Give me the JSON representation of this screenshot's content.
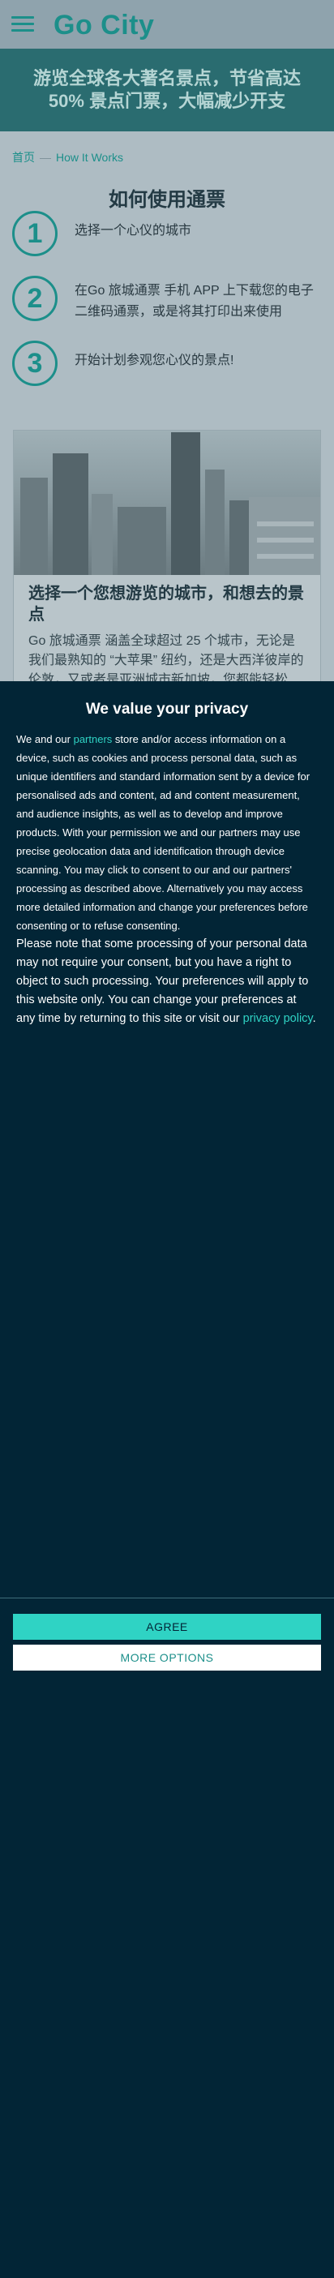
{
  "header": {
    "logo": "Go City"
  },
  "hero": {
    "title": "游览全球各大著名景点，节省高达 50% 景点门票，大幅减少开支"
  },
  "breadcrumb": {
    "home": "首页",
    "separator": "—",
    "current": "How It Works"
  },
  "how": {
    "title": "如何使用通票",
    "steps": [
      {
        "num": "1",
        "text": "选择一个心仪的城市"
      },
      {
        "num": "2",
        "text": "在Go 旅城通票 手机 APP 上下载您的电子二维码通票，或是将其打印出来使用"
      },
      {
        "num": "3",
        "text": "开始计划参观您心仪的景点!"
      }
    ]
  },
  "card": {
    "title": "选择一个您想游览的城市，和想去的景点",
    "text": "Go 旅城通票 涵盖全球超过 25 个城市，无论是我们最熟知的 “大苹果” 纽约，还是大西洋彼岸的伦敦，又或者是亚洲城市新加坡，您都能轻松"
  },
  "consent": {
    "title": "We value your privacy",
    "p1_pre": "We and our ",
    "p1_link": "partners",
    "p1_post": " store and/or access information on a device, such as cookies and process personal data, such as unique identifiers and standard information sent by a device for personalised ads and content, ad and content measurement, and audience insights, as well as to develop and improve products. With your permission we and our partners may use precise geolocation data and identification through device scanning. You may click to consent to our and our partners' processing as described above. Alternatively you may access more detailed information and change your preferences before consenting or to refuse consenting.",
    "p2_pre": "Please note that some processing of your personal data may not require your consent, but you have a right to object to such processing. Your preferences will apply to this website only. You can change your preferences at any time by returning to this site or visit our ",
    "p2_link": "privacy policy",
    "p2_post": ".",
    "agree": "AGREE",
    "more": "MORE OPTIONS"
  },
  "colors": {
    "accent": "#2fd3c4",
    "brand": "#1c8f8a",
    "overlay_bg": "#022536"
  }
}
